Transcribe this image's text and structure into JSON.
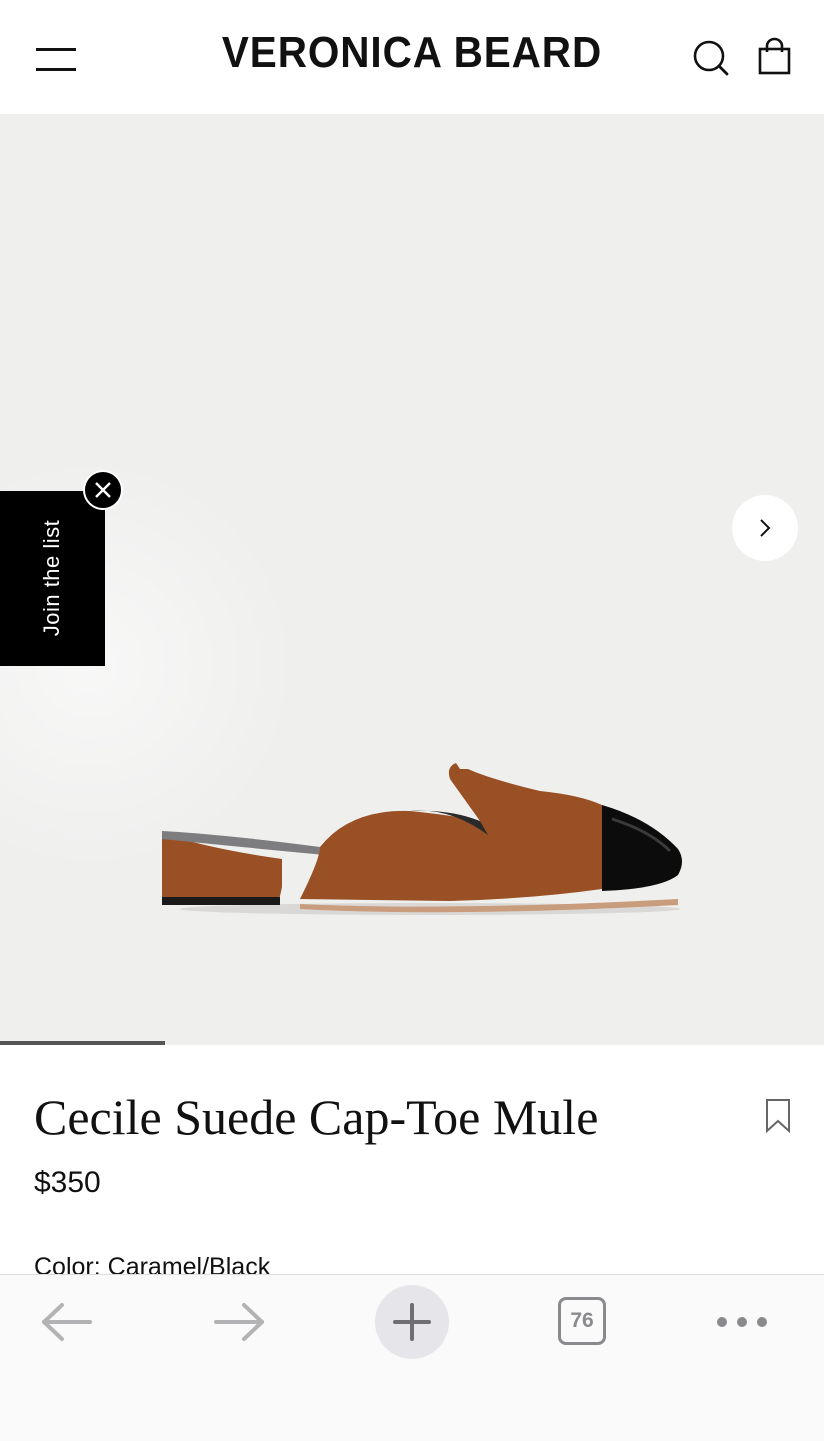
{
  "header": {
    "brand": "VERONICA BEARD",
    "icons": [
      "hamburger-menu-icon",
      "search-icon",
      "shopping-bag-icon"
    ]
  },
  "hero": {
    "image": "caramel-black-cap-toe-mule-shoe-photo",
    "gallery_progress": 0.2,
    "next_icon": "chevron-right-icon",
    "background": "#efefee"
  },
  "join_tab": {
    "label": "Join the list",
    "close_icon": "close-icon"
  },
  "product": {
    "title": "Cecile Suede Cap-Toe Mule",
    "price": "$350",
    "color_label": "Color:",
    "color_value": "Caramel/Black",
    "bookmark_icon": "bookmark-icon"
  },
  "browser_toolbar": {
    "tab_count": "76",
    "icons": [
      "back-arrow-icon",
      "forward-arrow-icon",
      "plus-icon",
      "tabs-icon",
      "more-icon"
    ]
  },
  "colors": {
    "shoe_suede": "#9a5025",
    "shoe_cap": "#0c0c0c",
    "toolbar_icon": "#8a8a8e"
  }
}
